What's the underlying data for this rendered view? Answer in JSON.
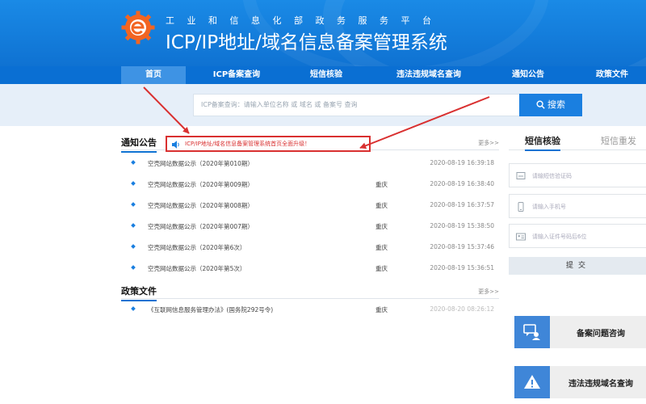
{
  "header": {
    "subtitle": "工业和信息化部政务服务平台",
    "title": "ICP/IP地址/域名信息备案管理系统",
    "logo_icon": "gear-e-logo-icon",
    "colors": {
      "bar": "#0f72d2",
      "accent_red": "#d93030",
      "logo_orange": "#f26522"
    }
  },
  "nav": {
    "items": [
      {
        "label": "首页",
        "active": true
      },
      {
        "label": "ICP备案查询"
      },
      {
        "label": "短信核验"
      },
      {
        "label": "违法违规域名查询"
      },
      {
        "label": "通知公告"
      },
      {
        "label": "政策文件"
      }
    ]
  },
  "search": {
    "placeholder": "ICP备案查询：请输入单位名称 或 域名 或 备案号 查询",
    "button_label": "搜索",
    "button_icon": "search-icon"
  },
  "notices": {
    "title": "通知公告",
    "more": "更多>>",
    "highlight": "ICP/IP地址/域名信息备案管理系统首页全面升级！",
    "highlight_icon": "speaker-icon",
    "rows": [
      {
        "title": "空壳网站数据公示（2020年第010期）",
        "city": "",
        "date": "2020-08-19 16:39:18"
      },
      {
        "title": "空壳网站数据公示（2020年第009期）",
        "city": "重庆",
        "date": "2020-08-19 16:38:40"
      },
      {
        "title": "空壳网站数据公示（2020年第008期）",
        "city": "重庆",
        "date": "2020-08-19 16:37:57"
      },
      {
        "title": "空壳网站数据公示（2020年第007期）",
        "city": "重庆",
        "date": "2020-08-19 15:38:50"
      },
      {
        "title": "空壳网站数据公示（2020年第6次）",
        "city": "重庆",
        "date": "2020-08-19 15:37:46"
      },
      {
        "title": "空壳网站数据公示（2020年第5次）",
        "city": "重庆",
        "date": "2020-08-19 15:36:51"
      }
    ]
  },
  "policy": {
    "title": "政策文件",
    "more": "更多>>",
    "rows": [
      {
        "title": "《互联网信息服务管理办法》(国务院292号令)",
        "city": "重庆",
        "date": "2020-08-20 08:26:12"
      }
    ]
  },
  "sms": {
    "tab_active": "短信核验",
    "tab_inactive": "短信重发",
    "fields": [
      {
        "placeholder": "请输短信验证码",
        "icon": "message-input-icon"
      },
      {
        "placeholder": "请输入手机号",
        "icon": "phone-icon"
      },
      {
        "placeholder": "请输入证件号码后6位",
        "icon": "id-card-icon"
      }
    ],
    "submit_label": "提交"
  },
  "side_cards": [
    {
      "label": "备案问题咨询",
      "icon": "consult-chat-icon"
    },
    {
      "label": "违法违规域名查询",
      "icon": "warning-icon"
    }
  ]
}
